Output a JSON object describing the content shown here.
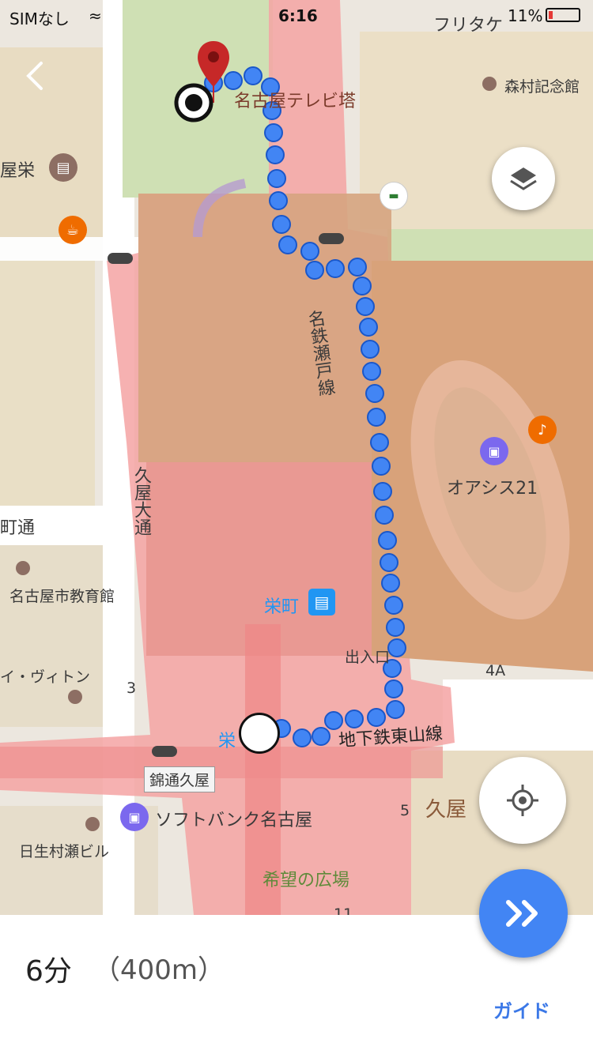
{
  "status_bar": {
    "carrier": "SIMなし",
    "time": "6:16",
    "battery": "11%"
  },
  "map": {
    "labels": {
      "tv_tower": "名古屋テレビ塔",
      "morimura": "森村記念館",
      "hotel_left": "屋栄",
      "meitetsu": "名鉄瀬戸線",
      "hisaya_odori": "久屋大通",
      "dori_left": "町通",
      "education_hall": "名古屋市教育館",
      "vuitton": "イ・ヴィトン",
      "three": "3",
      "oasis": "オアシス21",
      "sakaemachi": "栄町",
      "exit": "出入口",
      "exit_4a": "4A",
      "sakae": "栄",
      "subway_higashiyama": "地下鉄東山線",
      "nishiki": "錦通久屋",
      "softbank": "ソフトバンク名古屋",
      "five": "5",
      "hisaya_right": "久屋",
      "nissay": "日生村瀬ビル",
      "kibou": "希望の広場",
      "eleven": "11",
      "top_right_partial": "フリタケ"
    },
    "colors": {
      "route": "#4285f4",
      "highlight_area": "#f08a8a",
      "building_tan": "#d8a07c",
      "park": "#cfe0b4",
      "pin": "#c62828"
    }
  },
  "controls": {
    "back_icon": "chevron-left-icon",
    "layers_icon": "layers-icon",
    "my_location_icon": "crosshair-icon",
    "navigate_icon": "double-chevron-right-icon"
  },
  "route_summary": {
    "duration": "6分",
    "distance": "（400m）",
    "guide_label": "ガイド"
  }
}
